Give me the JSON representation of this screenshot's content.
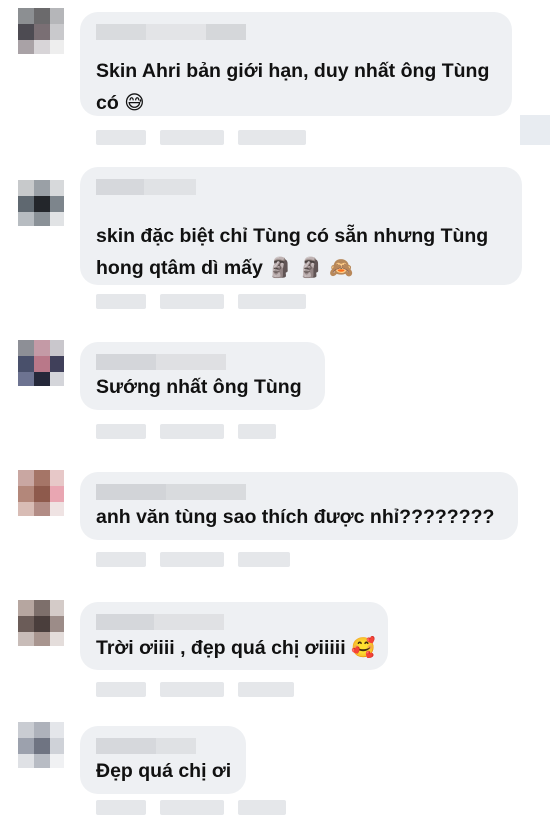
{
  "comments": [
    {
      "text_line1": "Skin Ahri bản giới hạn, duy nhất ông Tùng",
      "text_line2": "có",
      "emoji": "😅"
    },
    {
      "text_line1": "skin đặc biệt chỉ Tùng có sẵn nhưng Tùng",
      "text_line2": "hong qtâm dì mấy",
      "emoji": "🗿 🗿 🙈"
    },
    {
      "text_line1": "Sướng nhất ông Tùng"
    },
    {
      "text_line1": "anh văn tùng sao thích được nhỉ????????"
    },
    {
      "text_line1": "Trời ơiiii , đẹp quá chị ơiiiii",
      "emoji": "🥰"
    },
    {
      "text_line1": "Đẹp quá chị ơi"
    }
  ],
  "colors": {
    "bubble": "#eef0f3",
    "text": "#111111",
    "blur": "#d6d8dc"
  }
}
